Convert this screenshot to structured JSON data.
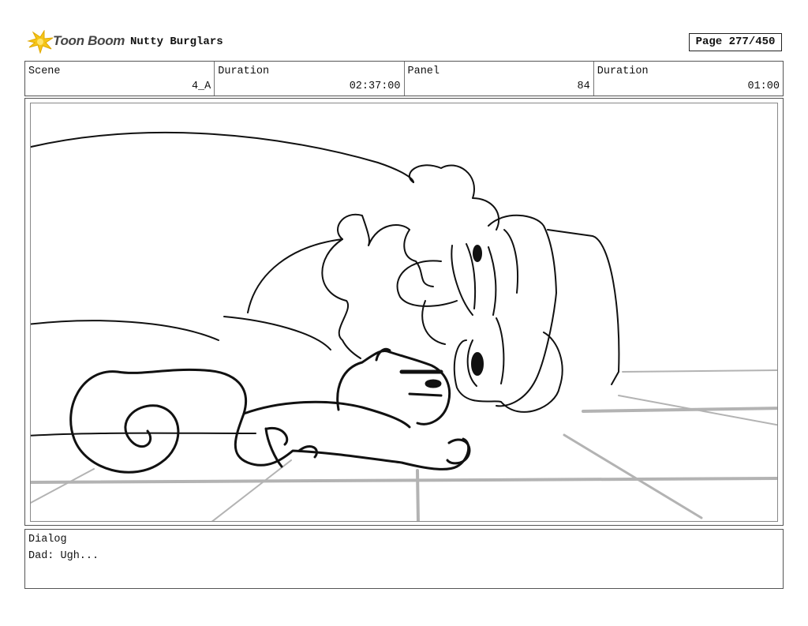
{
  "header": {
    "logo_text": "Toon Boom",
    "project_title": "Nutty Burglars",
    "page": "Page 277/450"
  },
  "info": {
    "scene_label": "Scene",
    "scene_value": "4_A",
    "duration_label": "Duration",
    "duration_value": "02:37:00",
    "panel_label": "Panel",
    "panel_value": "84",
    "panel_duration_label": "Duration",
    "panel_duration_value": "01:00"
  },
  "dialog": {
    "label": "Dialog",
    "text": "Dad: Ugh..."
  },
  "colors": {
    "ink": "#111111",
    "floor_lines": "#b3b3b3",
    "logo_flash": "#f5c518"
  }
}
